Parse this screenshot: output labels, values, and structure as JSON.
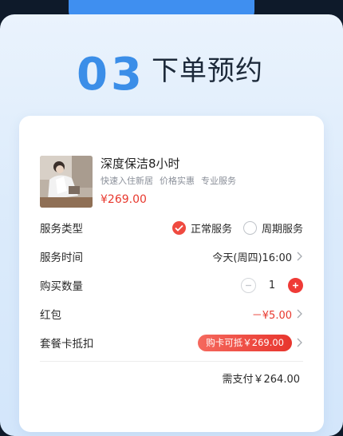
{
  "step": {
    "number": "03",
    "title": "下单预约"
  },
  "product": {
    "title": "深度保洁8小时",
    "tags": [
      "快速入住新居",
      "价格实惠",
      "专业服务"
    ],
    "price": "¥269.00"
  },
  "service_type": {
    "label": "服务类型",
    "options": [
      {
        "label": "正常服务",
        "selected": true
      },
      {
        "label": "周期服务",
        "selected": false
      }
    ]
  },
  "service_time": {
    "label": "服务时间",
    "value": "今天(周四)16:00"
  },
  "quantity": {
    "label": "购买数量",
    "value": "1"
  },
  "red_packet": {
    "label": "红包",
    "value": "－¥5.00"
  },
  "package_card": {
    "label": "套餐卡抵扣",
    "value": "购卡可抵￥269.00"
  },
  "total": {
    "text": "需支付￥264.00"
  },
  "colors": {
    "accent_blue": "#3b8ee8",
    "accent_red": "#e8382e",
    "background": "#dcebfb"
  }
}
